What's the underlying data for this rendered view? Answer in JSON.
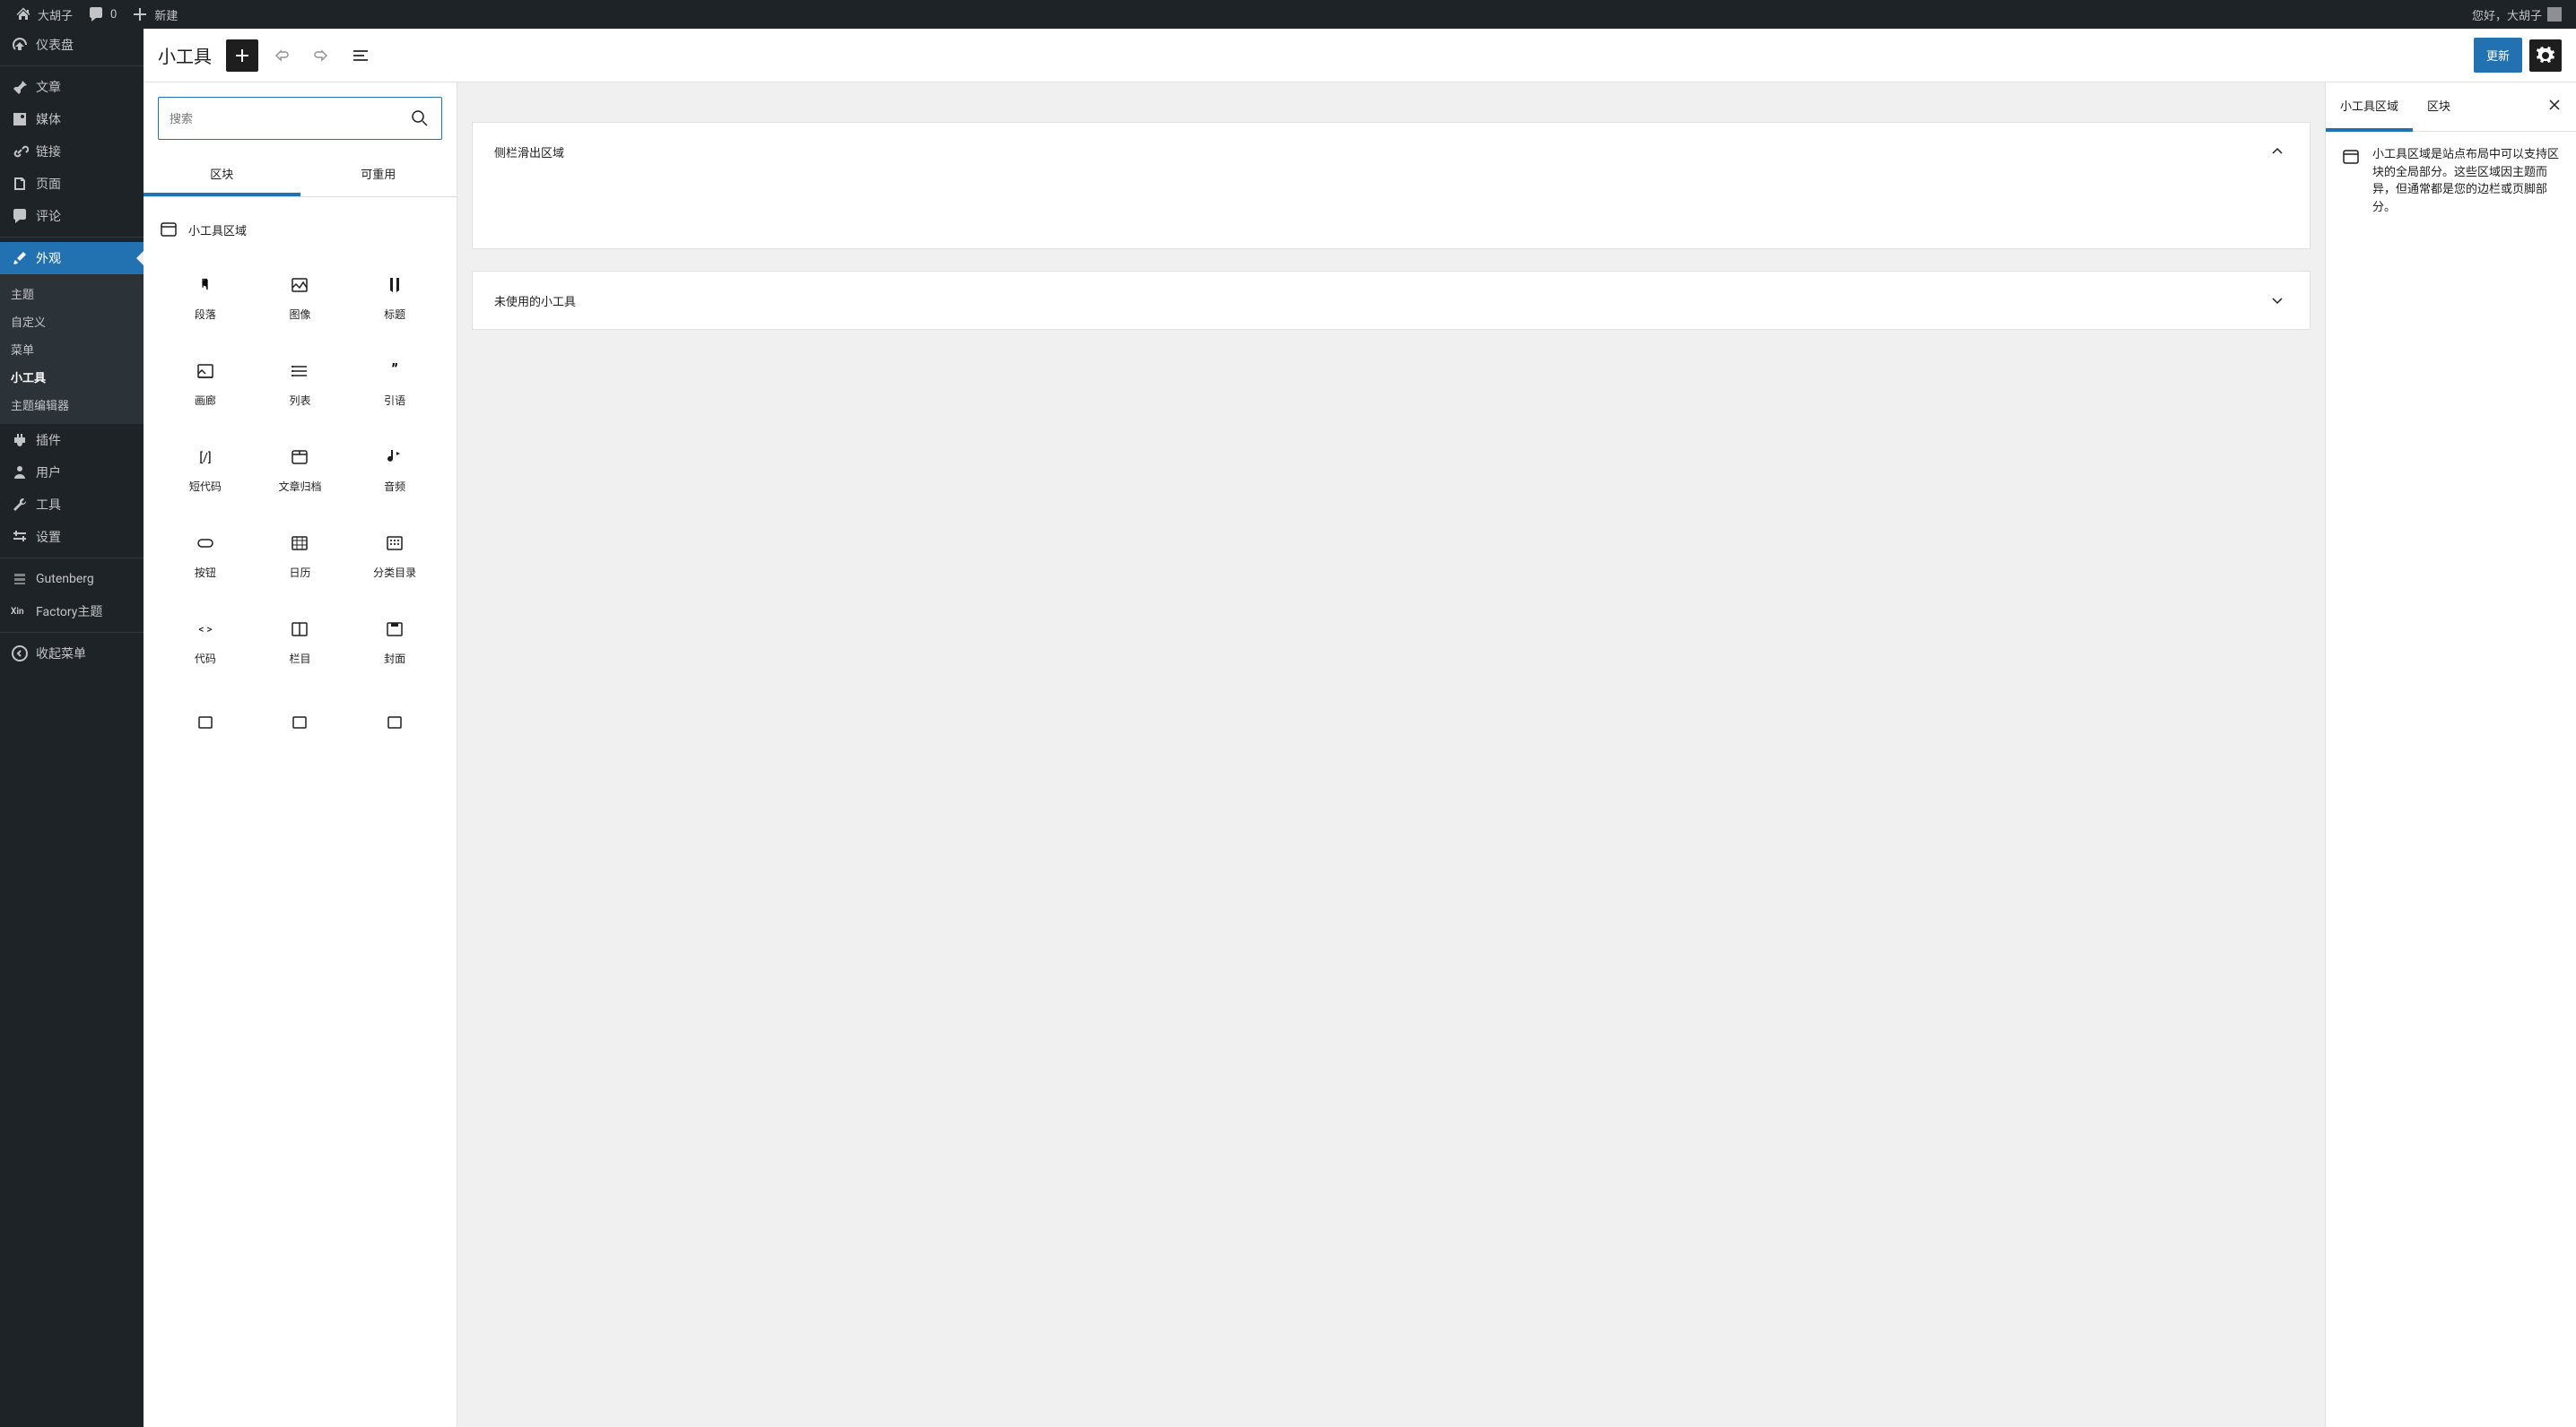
{
  "adminbar": {
    "site": "大胡子",
    "comments": "0",
    "new": "新建",
    "greeting": "您好，大胡子"
  },
  "sidebar": {
    "dashboard": "仪表盘",
    "posts": "文章",
    "media": "媒体",
    "links": "链接",
    "pages": "页面",
    "comments": "评论",
    "appearance": "外观",
    "sub_themes": "主题",
    "sub_customize": "自定义",
    "sub_menus": "菜单",
    "sub_widgets": "小工具",
    "sub_editor": "主题编辑器",
    "plugins": "插件",
    "users": "用户",
    "tools": "工具",
    "settings": "设置",
    "gutenberg": "Gutenberg",
    "factory": "Factory主题",
    "collapse": "收起菜单"
  },
  "header": {
    "title": "小工具",
    "update": "更新"
  },
  "inserter": {
    "search_placeholder": "搜索",
    "tab_blocks": "区块",
    "tab_reusable": "可重用",
    "category": "小工具区域",
    "blocks": [
      "段落",
      "图像",
      "标题",
      "画廊",
      "列表",
      "引语",
      "短代码",
      "文章归档",
      "音频",
      "按钮",
      "日历",
      "分类目录",
      "代码",
      "栏目",
      "封面"
    ]
  },
  "canvas": {
    "area1": "侧栏滑出区域",
    "area2": "未使用的小工具"
  },
  "settings": {
    "tab_areas": "小工具区域",
    "tab_block": "区块",
    "description": "小工具区域是站点布局中可以支持区块的全局部分。这些区域因主题而异，但通常都是您的边栏或页脚部分。"
  }
}
